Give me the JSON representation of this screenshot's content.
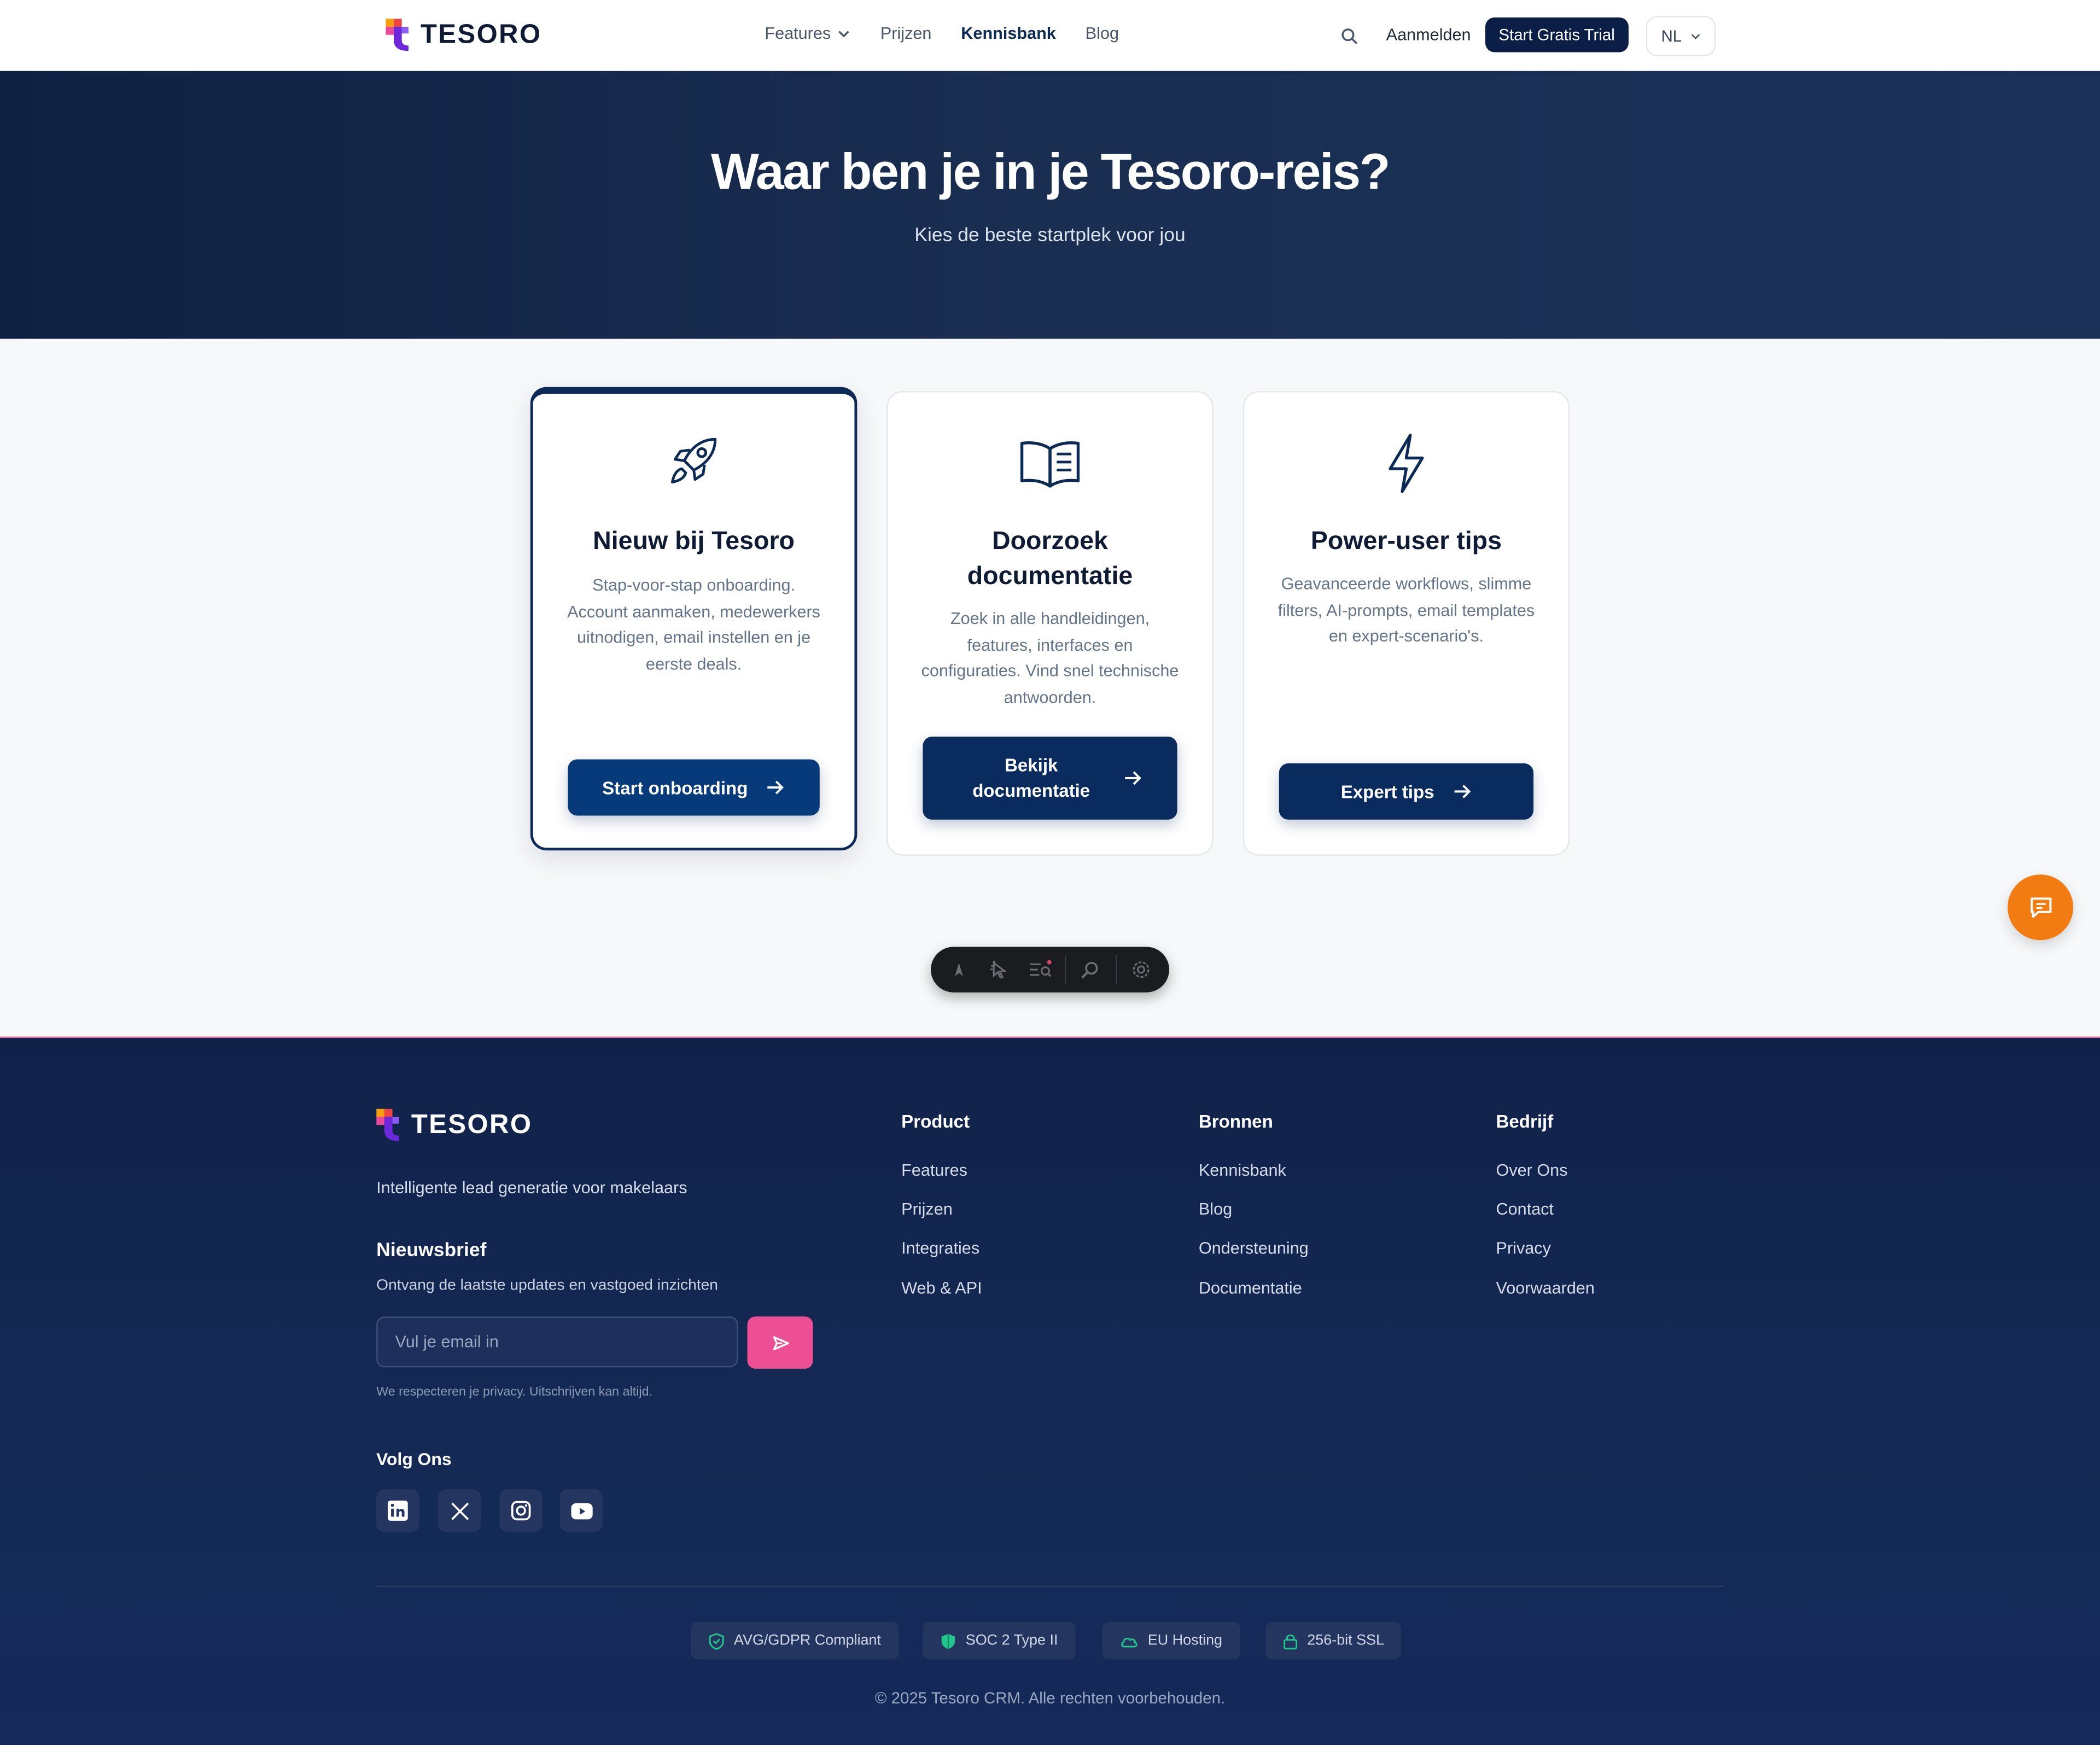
{
  "header": {
    "brand": "TESORO",
    "nav": [
      {
        "label": "Features",
        "has_dropdown": true,
        "active": false
      },
      {
        "label": "Prijzen",
        "active": false
      },
      {
        "label": "Kennisbank",
        "active": true
      },
      {
        "label": "Blog",
        "active": false
      }
    ],
    "search_icon": "search-icon",
    "login_label": "Aanmelden",
    "trial_label": "Start Gratis Trial",
    "language": "NL"
  },
  "hero": {
    "title": "Waar ben je in je Tesoro-reis?",
    "subtitle": "Kies de beste startplek voor jou"
  },
  "cards": [
    {
      "icon": "rocket-icon",
      "title": "Nieuw bij Tesoro",
      "description": "Stap-voor-stap onboarding. Account aanmaken, medewerkers uitnodigen, email instellen en je eerste deals.",
      "button": "Start onboarding",
      "featured": true
    },
    {
      "icon": "book-icon",
      "title": "Doorzoek documentatie",
      "description": "Zoek in alle handleidingen, features, interfaces en configuraties. Vind snel technische antwoorden.",
      "button": "Bekijk documentatie",
      "featured": false
    },
    {
      "icon": "lightning-icon",
      "title": "Power-user tips",
      "description": "Geavanceerde workflows, slimme filters, AI-prompts, email templates en expert-scenario's.",
      "button": "Expert tips",
      "featured": false
    }
  ],
  "chat_icon": "chat-icon",
  "dev_toolbar_icons": [
    "astro-icon",
    "pointer-icon",
    "audit-icon",
    "search-settings-icon",
    "gear-icon"
  ],
  "footer": {
    "brand": "TESORO",
    "tagline": "Intelligente lead generatie voor makelaars",
    "newsletter": {
      "title": "Nieuwsbrief",
      "description": "Ontvang de laatste updates en vastgoed inzichten",
      "placeholder": "Vul je email in",
      "privacy": "We respecteren je privacy. Uitschrijven kan altijd."
    },
    "follow_title": "Volg Ons",
    "socials": [
      "linkedin-icon",
      "x-icon",
      "instagram-icon",
      "youtube-icon"
    ],
    "columns": [
      {
        "title": "Product",
        "links": [
          "Features",
          "Prijzen",
          "Integraties",
          "Web & API"
        ]
      },
      {
        "title": "Bronnen",
        "links": [
          "Kennisbank",
          "Blog",
          "Ondersteuning",
          "Documentatie"
        ]
      },
      {
        "title": "Bedrijf",
        "links": [
          "Over Ons",
          "Contact",
          "Privacy",
          "Voorwaarden"
        ]
      }
    ],
    "badges": [
      "AVG/GDPR Compliant",
      "SOC 2 Type II",
      "EU Hosting",
      "256-bit SSL"
    ],
    "copyright": "© 2025 Tesoro CRM. Alle rechten voorbehouden."
  },
  "colors": {
    "navy": "#0b1e45",
    "button_blue": "#0a2b5e",
    "accent_pink": "#ec4f93",
    "chat_orange": "#f27b12",
    "badge_green": "#22c58b"
  }
}
